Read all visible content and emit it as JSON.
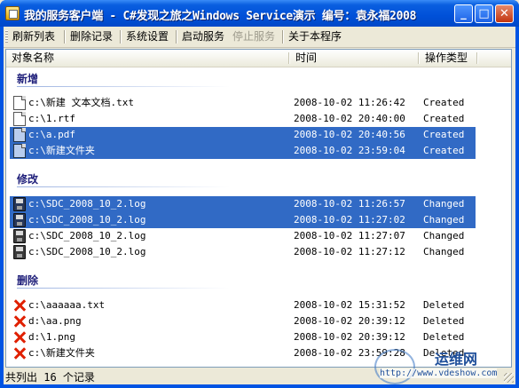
{
  "window": {
    "title": "我的服务客户端 - C#发现之旅之Windows Service演示 编号：袁永福2008",
    "min_glyph": "_",
    "max_glyph": "□",
    "close_glyph": "✕"
  },
  "toolbar": {
    "items": [
      {
        "label": "刷新列表",
        "enabled": true
      },
      {
        "label": "删除记录",
        "enabled": true
      },
      {
        "label": "系统设置",
        "enabled": true
      },
      {
        "label": "启动服务",
        "enabled": true
      },
      {
        "label": "停止服务",
        "enabled": false
      },
      {
        "label": "关于本程序",
        "enabled": true
      }
    ]
  },
  "list": {
    "columns": [
      "对象名称",
      "时间",
      "操作类型"
    ],
    "groups": [
      {
        "title": "新增",
        "rows": [
          {
            "icon": "document-icon",
            "name": "c:\\新建 文本文档.txt",
            "time": "2008-10-02 11:26:42",
            "type": "Created",
            "selected": false
          },
          {
            "icon": "document-icon",
            "name": "c:\\1.rtf",
            "time": "2008-10-02 20:40:00",
            "type": "Created",
            "selected": false
          },
          {
            "icon": "document-icon",
            "name": "c:\\a.pdf",
            "time": "2008-10-02 20:40:56",
            "type": "Created",
            "selected": true
          },
          {
            "icon": "document-icon",
            "name": "c:\\新建文件夹",
            "time": "2008-10-02 23:59:04",
            "type": "Created",
            "selected": true
          }
        ]
      },
      {
        "title": "修改",
        "rows": [
          {
            "icon": "floppy-disk-icon",
            "name": "c:\\SDC_2008_10_2.log",
            "time": "2008-10-02 11:26:57",
            "type": "Changed",
            "selected": true
          },
          {
            "icon": "floppy-disk-icon",
            "name": "c:\\SDC_2008_10_2.log",
            "time": "2008-10-02 11:27:02",
            "type": "Changed",
            "selected": true
          },
          {
            "icon": "floppy-disk-icon",
            "name": "c:\\SDC_2008_10_2.log",
            "time": "2008-10-02 11:27:07",
            "type": "Changed",
            "selected": false
          },
          {
            "icon": "floppy-disk-icon",
            "name": "c:\\SDC_2008_10_2.log",
            "time": "2008-10-02 11:27:12",
            "type": "Changed",
            "selected": false
          }
        ]
      },
      {
        "title": "删除",
        "rows": [
          {
            "icon": "delete-x-icon",
            "name": "c:\\aaaaaa.txt",
            "time": "2008-10-02 15:31:52",
            "type": "Deleted",
            "selected": false
          },
          {
            "icon": "delete-x-icon",
            "name": "d:\\aa.png",
            "time": "2008-10-02 20:39:12",
            "type": "Deleted",
            "selected": false
          },
          {
            "icon": "delete-x-icon",
            "name": "d:\\1.png",
            "time": "2008-10-02 20:39:12",
            "type": "Deleted",
            "selected": false
          },
          {
            "icon": "delete-x-icon",
            "name": "c:\\新建文件夹",
            "time": "2008-10-02 23:59:28",
            "type": "Deleted",
            "selected": false
          }
        ]
      }
    ]
  },
  "status": {
    "text": "共列出 16 个记录"
  },
  "watermark": {
    "name": "运维网",
    "url": "http://www.vdeshow.com"
  },
  "colors": {
    "titlebar": "#0054e3",
    "selection": "#316ac5",
    "delete_icon": "#e02000",
    "group_title": "#1f1f7a"
  }
}
